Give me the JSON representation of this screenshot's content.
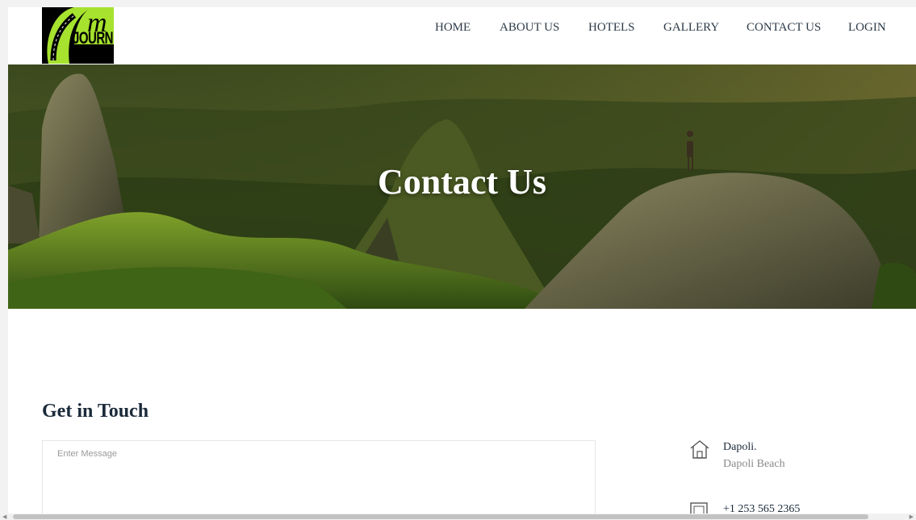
{
  "logo": {
    "text": "JOURNEY"
  },
  "nav": {
    "items": [
      {
        "id": "home",
        "label": "HOME"
      },
      {
        "id": "about",
        "label": "ABOUT US"
      },
      {
        "id": "hotels",
        "label": "HOTELS"
      },
      {
        "id": "gallery",
        "label": "GALLERY"
      },
      {
        "id": "contact",
        "label": "CONTACT US"
      },
      {
        "id": "login",
        "label": "LOGIN"
      }
    ]
  },
  "hero": {
    "title": "Contact Us"
  },
  "contact_form": {
    "heading": "Get in Touch",
    "message_placeholder": "Enter Message"
  },
  "contact_info": {
    "address_title": "Dapoli.",
    "address_sub": "Dapoli Beach",
    "phone": "+1 253 565 2365"
  },
  "colors": {
    "accent_green": "#a6e22e",
    "heading": "#1b2a3a",
    "nav_text": "#2c3a47"
  }
}
